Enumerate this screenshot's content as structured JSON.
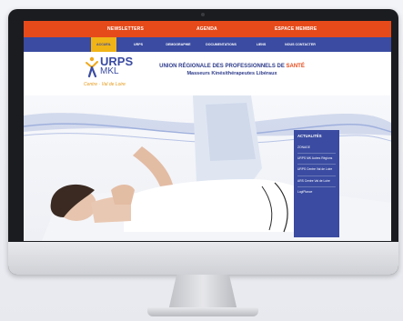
{
  "topbar": {
    "items": [
      "NEWSLETTERS",
      "AGENDA",
      "ESPACE MEMBRE"
    ]
  },
  "nav": {
    "items": [
      "ACCUEIL",
      "URPS",
      "DEMOGRAPHIE",
      "DOCUMENTATIONS",
      "LIENS",
      "NOUS CONTACTER"
    ],
    "active_index": 0
  },
  "logo": {
    "name": "URPS",
    "sub": "MKL",
    "region": "Centre · Val de Loire"
  },
  "headline": {
    "line1_prefix": "UNION RÉGIONALE DES PROFESSIONNELS DE",
    "line1_accent": "SANTÉ",
    "line2": "Masseurs Kinésithérapeutes Libéraux"
  },
  "sidebar": {
    "title": "ACTUALITÉS",
    "items": [
      "ZONAGE",
      "URPS MK Autres Régions",
      "URPS Centre Val de Loire",
      "ARS Centre Val de Loire",
      "LogiPlance"
    ]
  },
  "colors": {
    "topbar": "#e64a1a",
    "nav": "#3a4ba1",
    "nav_active": "#f0b416",
    "sidebar": "#3a4ba1"
  }
}
